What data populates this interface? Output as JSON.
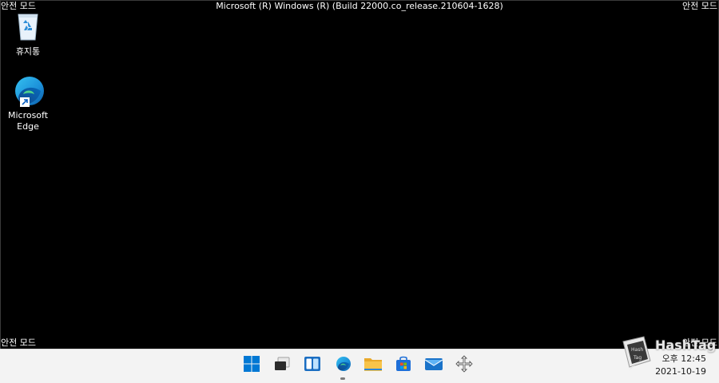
{
  "safe_mode_label": "안전 모드",
  "title": "Microsoft (R) Windows (R) (Build 22000.co_release.210604-1628)",
  "desktop_icons": [
    {
      "label": "휴지통",
      "icon": "recycle-bin-icon"
    },
    {
      "label": "Microsoft Edge",
      "icon": "edge-icon"
    }
  ],
  "taskbar": {
    "apps": [
      {
        "name": "start",
        "icon": "windows-logo-icon"
      },
      {
        "name": "task-view",
        "icon": "task-view-icon"
      },
      {
        "name": "widgets",
        "icon": "widgets-icon"
      },
      {
        "name": "edge",
        "icon": "edge-icon",
        "running": true
      },
      {
        "name": "file-explorer",
        "icon": "folder-icon"
      },
      {
        "name": "store",
        "icon": "store-icon"
      },
      {
        "name": "mail",
        "icon": "mail-icon"
      },
      {
        "name": "move",
        "icon": "move-arrows-icon"
      }
    ],
    "clock": {
      "time": "오후 12:45",
      "date": "2021-10-19"
    }
  },
  "watermark": {
    "text": "HashTag",
    "logo": "hashtag-logo-icon"
  },
  "colors": {
    "desktop_bg": "#000000",
    "taskbar_bg": "#f3f3f3",
    "windows_blue": "#0078d4",
    "folder_yellow": "#f8c44a",
    "store_blue": "#1e6fd8"
  }
}
